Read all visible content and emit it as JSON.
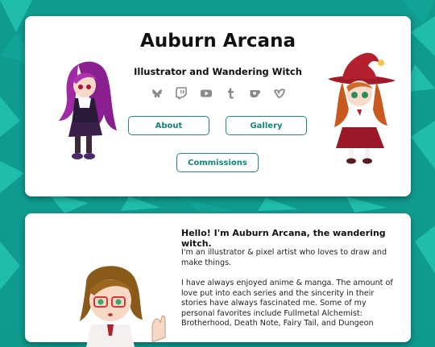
{
  "header": {
    "title": "Auburn Arcana",
    "subtitle": "Illustrator and Wandering Witch"
  },
  "social_icons": [
    "bluesky-icon",
    "twitch-icon",
    "youtube-icon",
    "tumblr-icon",
    "kofi-icon",
    "vgen-icon"
  ],
  "nav": {
    "about_label": "About",
    "gallery_label": "Gallery",
    "commissions_label": "Commissions"
  },
  "bio": {
    "heading": "Hello! I'm Auburn Arcana, the wandering witch.",
    "paragraph1": "I'm an illustrator & pixel artist who loves to draw and make things.",
    "paragraph2": "I have always enjoyed anime & manga. The amount of love put into each series and the sincerity in their stories have always fascinated me. Some of my personal favorites include Fullmetal Alchemist: Brotherhood, Death Note, Fairy Tail, and Dungeon"
  },
  "colors": {
    "background": "#0e9a8d",
    "accent": "#12867c",
    "card": "#ffffff"
  }
}
